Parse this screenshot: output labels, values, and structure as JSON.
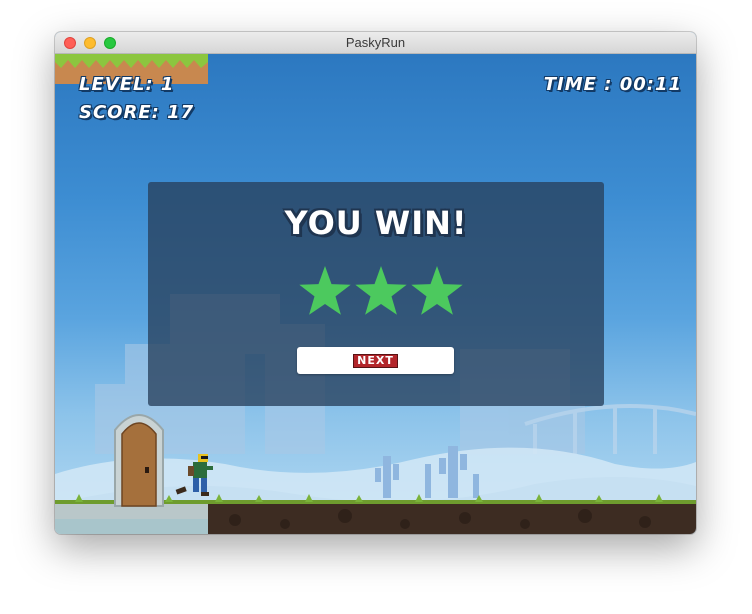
{
  "window": {
    "title": "PaskyRun"
  },
  "hud": {
    "level": "LEVEL: 1",
    "score": "SCORE: 17",
    "time": "TIME : 00:11"
  },
  "dialog": {
    "title": "YOU WIN!",
    "stars_earned": 3,
    "stars_total": 3,
    "star_color": "#4cc95e",
    "next_label": "NEXT"
  },
  "colors": {
    "sky": "#3d8dd2",
    "overlay": "#28405c",
    "grass": "#6e9c2e",
    "dirt": "#3d2c22"
  }
}
